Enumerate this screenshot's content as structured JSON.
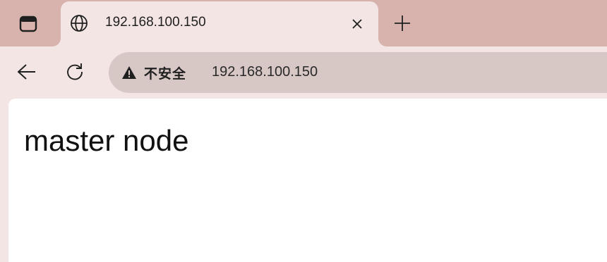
{
  "tab": {
    "title": "192.168.100.150",
    "close_glyph": "×"
  },
  "new_tab_glyph": "+",
  "toolbar": {
    "security_label": "不安全",
    "url": "192.168.100.150"
  },
  "page": {
    "heading": "master node"
  },
  "icons": {
    "sidebar": "sidebar-panel-icon",
    "favicon": "globe-icon",
    "back": "arrow-left-icon",
    "reload": "reload-icon",
    "security": "warning-triangle-icon"
  },
  "colors": {
    "tabstrip": "#d8b3ad",
    "active_tab": "#f3e5e4",
    "omnibox": "#d7c7c5",
    "content_bg": "#ffffff"
  }
}
